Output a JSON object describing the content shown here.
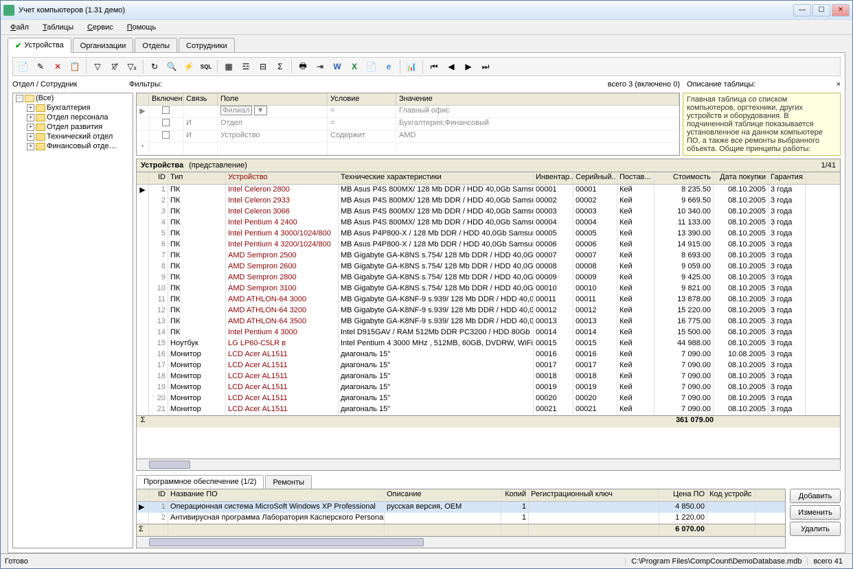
{
  "window": {
    "title": "Учет компьютеров (1.31 демо)"
  },
  "menu": [
    "Файл",
    "Таблицы",
    "Сервис",
    "Помощь"
  ],
  "tabs": [
    "Устройства",
    "Организации",
    "Отделы",
    "Сотрудники"
  ],
  "labels": {
    "dept": "Отдел / Сотрудник",
    "filters": "Фильтры:",
    "filter_count": "всего 3 (включено 0)",
    "desc_title": "Описание таблицы:"
  },
  "filter_cols": {
    "on": "Включен",
    "link": "Связь",
    "field": "Поле",
    "cond": "Условие",
    "val": "Значение"
  },
  "filters_rows": [
    {
      "marker": "▶",
      "link": "",
      "field": "Филиал",
      "cond": "=",
      "val": "Главный офис"
    },
    {
      "marker": "",
      "link": "И",
      "field": "Отдел",
      "cond": "=",
      "val": "Бухгалтерия;Финансовый"
    },
    {
      "marker": "",
      "link": "И",
      "field": "Устройство",
      "cond": "Содержит",
      "val": "AMD"
    },
    {
      "marker": "*",
      "link": "",
      "field": "",
      "cond": "",
      "val": ""
    }
  ],
  "desc_text": "Главная таблица со списком компьютеров, оргтехники, других устройств и оборудования. В подчиненной таблице показывается установленное на данном компьютере ПО, а также все ремонты выбранного объекта. Общие принципы работы:",
  "tree": [
    {
      "exp": "-",
      "label": "(Все)",
      "open": true,
      "indent": 0
    },
    {
      "exp": "+",
      "label": "Бухгалтерия",
      "indent": 1
    },
    {
      "exp": "+",
      "label": "Отдел персонала",
      "indent": 1
    },
    {
      "exp": "+",
      "label": "Отдел развития",
      "indent": 1
    },
    {
      "exp": "+",
      "label": "Технический отдел",
      "indent": 1
    },
    {
      "exp": "+",
      "label": "Финансовый отде…",
      "indent": 1
    }
  ],
  "grid": {
    "title": "Устройства",
    "view": "(представление)",
    "count": "1/41",
    "cols": {
      "id": "ID",
      "type": "Тип",
      "dev": "Устройство",
      "tech": "Технические характеристики",
      "inv": "Инвентар..",
      "ser": "Серийный..",
      "sup": "Постав...",
      "cost": "Стоимость",
      "date": "Дата покупки",
      "war": "Гарантия"
    },
    "rows": [
      {
        "id": 1,
        "type": "ПК",
        "dev": "Intel Celeron 2800",
        "tech": "MB Asus P4S 800MX/ 128 Mb DDR / HDD 40,0Gb Samsu",
        "inv": "00001",
        "ser": "00001",
        "sup": "Кей",
        "cost": "8 235.50",
        "date": "08.10.2005",
        "war": "3 года",
        "sel": true
      },
      {
        "id": 2,
        "type": "ПК",
        "dev": "Intel Celeron 2933",
        "tech": "MB Asus P4S 800MX/ 128 Mb DDR / HDD 40,0Gb Samsu",
        "inv": "00002",
        "ser": "00002",
        "sup": "Кей",
        "cost": "9 669.50",
        "date": "08.10.2005",
        "war": "3 года"
      },
      {
        "id": 3,
        "type": "ПК",
        "dev": "Intel Celeron 3066",
        "tech": "MB Asus P4S 800MX/ 128 Mb DDR / HDD 40,0Gb Samsu",
        "inv": "00003",
        "ser": "00003",
        "sup": "Кей",
        "cost": "10 340.00",
        "date": "08.10.2005",
        "war": "3 года"
      },
      {
        "id": 4,
        "type": "ПК",
        "dev": "Intel Pentium 4 2400",
        "tech": "MB Asus P4S 800MX/ 128 Mb DDR / HDD 40,0Gb Samsu",
        "inv": "00004",
        "ser": "00004",
        "sup": "Кей",
        "cost": "11 133.00",
        "date": "08.10.2005",
        "war": "3 года"
      },
      {
        "id": 5,
        "type": "ПК",
        "dev": "Intel Pentium 4 3000/1024/800",
        "tech": "MB Asus P4P800-X / 128 Mb DDR / HDD 40,0Gb Samsur",
        "inv": "00005",
        "ser": "00005",
        "sup": "Кей",
        "cost": "13 390.00",
        "date": "08.10.2005",
        "war": "3 года"
      },
      {
        "id": 6,
        "type": "ПК",
        "dev": "Intel Pentium 4 3200/1024/800",
        "tech": "MB Asus P4P800-X / 128 Mb DDR / HDD 40,0Gb Samsur",
        "inv": "00006",
        "ser": "00006",
        "sup": "Кей",
        "cost": "14 915.00",
        "date": "08.10.2005",
        "war": "3 года"
      },
      {
        "id": 7,
        "type": "ПК",
        "dev": "AMD Sempron 2500",
        "tech": "MB Gigabyte GA-K8NS s.754/ 128 Mb DDR / HDD 40,0Gt",
        "inv": "00007",
        "ser": "00007",
        "sup": "Кей",
        "cost": "8 693.00",
        "date": "08.10.2005",
        "war": "3 года"
      },
      {
        "id": 8,
        "type": "ПК",
        "dev": "AMD Sempron 2600",
        "tech": "MB Gigabyte GA-K8NS s.754/ 128 Mb DDR / HDD 40,0Gt",
        "inv": "00008",
        "ser": "00008",
        "sup": "Кей",
        "cost": "9 059.00",
        "date": "08.10.2005",
        "war": "3 года"
      },
      {
        "id": 9,
        "type": "ПК",
        "dev": "AMD Sempron 2800",
        "tech": "MB Gigabyte GA-K8NS s.754/ 128 Mb DDR / HDD 40,0Gt",
        "inv": "00009",
        "ser": "00009",
        "sup": "Кей",
        "cost": "9 425.00",
        "date": "08.10.2005",
        "war": "3 года"
      },
      {
        "id": 10,
        "type": "ПК",
        "dev": "AMD Sempron 3100",
        "tech": "MB Gigabyte GA-K8NS s.754/ 128 Mb DDR / HDD 40,0Gt",
        "inv": "00010",
        "ser": "00010",
        "sup": "Кей",
        "cost": "9 821.00",
        "date": "08.10.2005",
        "war": "3 года"
      },
      {
        "id": 11,
        "type": "ПК",
        "dev": "AMD ATHLON-64 3000",
        "tech": "MB Gigabyte GA-K8NF-9 s.939/ 128 Mb DDR / HDD 40,0",
        "inv": "00011",
        "ser": "00011",
        "sup": "Кей",
        "cost": "13 878.00",
        "date": "08.10.2005",
        "war": "3 года"
      },
      {
        "id": 12,
        "type": "ПК",
        "dev": "AMD ATHLON-64 3200",
        "tech": "MB Gigabyte GA-K8NF-9 s.939/ 128 Mb DDR / HDD 40,0",
        "inv": "00012",
        "ser": "00012",
        "sup": "Кей",
        "cost": "15 220.00",
        "date": "08.10.2005",
        "war": "3 года"
      },
      {
        "id": 13,
        "type": "ПК",
        "dev": "AMD ATHLON-64 3500",
        "tech": "MB Gigabyte GA-K8NF-9 s.939/ 128 Mb DDR / HDD 40,0",
        "inv": "00013",
        "ser": "00013",
        "sup": "Кей",
        "cost": "16 775.00",
        "date": "08.10.2005",
        "war": "3 года"
      },
      {
        "id": 14,
        "type": "ПК",
        "dev": "Intel Pentium 4 3000",
        "tech": "Intel D915GAV / RAM 512Mb DDR PC3200 / HDD 80Gb",
        "inv": "00014",
        "ser": "00014",
        "sup": "Кей",
        "cost": "15 500.00",
        "date": "08.10.2005",
        "war": "3 года"
      },
      {
        "id": 15,
        "type": "Ноутбук",
        "dev": "LG LP60-C5LR в",
        "tech": "Intel Pentium 4 3000 MHz , 512MB, 60GB, DVDRW, WiFi,",
        "inv": "00015",
        "ser": "00015",
        "sup": "Кей",
        "cost": "44 988.00",
        "date": "08.10.2005",
        "war": "3 года"
      },
      {
        "id": 16,
        "type": "Монитор",
        "dev": "LCD Acer AL1511",
        "tech": "диагональ 15\"",
        "inv": "00016",
        "ser": "00016",
        "sup": "Кей",
        "cost": "7 090.00",
        "date": "10.08.2005",
        "war": "3 года"
      },
      {
        "id": 17,
        "type": "Монитор",
        "dev": "LCD Acer AL1511",
        "tech": "диагональ 15\"",
        "inv": "00017",
        "ser": "00017",
        "sup": "Кей",
        "cost": "7 090.00",
        "date": "08.10.2005",
        "war": "3 года"
      },
      {
        "id": 18,
        "type": "Монитор",
        "dev": "LCD Acer AL1511",
        "tech": "диагональ 15\"",
        "inv": "00018",
        "ser": "00018",
        "sup": "Кей",
        "cost": "7 090.00",
        "date": "08.10.2005",
        "war": "3 года"
      },
      {
        "id": 19,
        "type": "Монитор",
        "dev": "LCD Acer AL1511",
        "tech": "диагональ 15\"",
        "inv": "00019",
        "ser": "00019",
        "sup": "Кей",
        "cost": "7 090.00",
        "date": "08.10.2005",
        "war": "3 года"
      },
      {
        "id": 20,
        "type": "Монитор",
        "dev": "LCD Acer AL1511",
        "tech": "диагональ 15\"",
        "inv": "00020",
        "ser": "00020",
        "sup": "Кей",
        "cost": "7 090.00",
        "date": "08.10.2005",
        "war": "3 года"
      },
      {
        "id": 21,
        "type": "Монитор",
        "dev": "LCD Acer AL1511",
        "tech": "диагональ 15\"",
        "inv": "00021",
        "ser": "00021",
        "sup": "Кей",
        "cost": "7 090.00",
        "date": "08.10.2005",
        "war": "3 года"
      }
    ],
    "sum": "361 079.00"
  },
  "subtabs": {
    "software": "Программное обеспечение (1/2)",
    "repairs": "Ремонты"
  },
  "sw": {
    "cols": {
      "id": "ID",
      "name": "Название ПО",
      "desc": "Описание",
      "cop": "Копий",
      "key": "Регистрационный ключ",
      "price": "Цена ПО",
      "code": "Код устройс"
    },
    "rows": [
      {
        "id": 1,
        "name": "Операционная система MicroSoft Windows XP Professional",
        "desc": "русская версия, OEM",
        "cop": 1,
        "price": "4 850.00",
        "sel": true
      },
      {
        "id": 2,
        "name": "Антивирусная программа Лаборатория Касперского Personal",
        "desc": "",
        "cop": 1,
        "price": "1 220.00"
      }
    ],
    "sum": "6 070.00"
  },
  "buttons": {
    "add": "Добавить",
    "edit": "Изменить",
    "del": "Удалить"
  },
  "status": {
    "ready": "Готово",
    "path": "C:\\Program Files\\CompCount\\DemoDatabase.mdb",
    "total": "всего 41"
  }
}
